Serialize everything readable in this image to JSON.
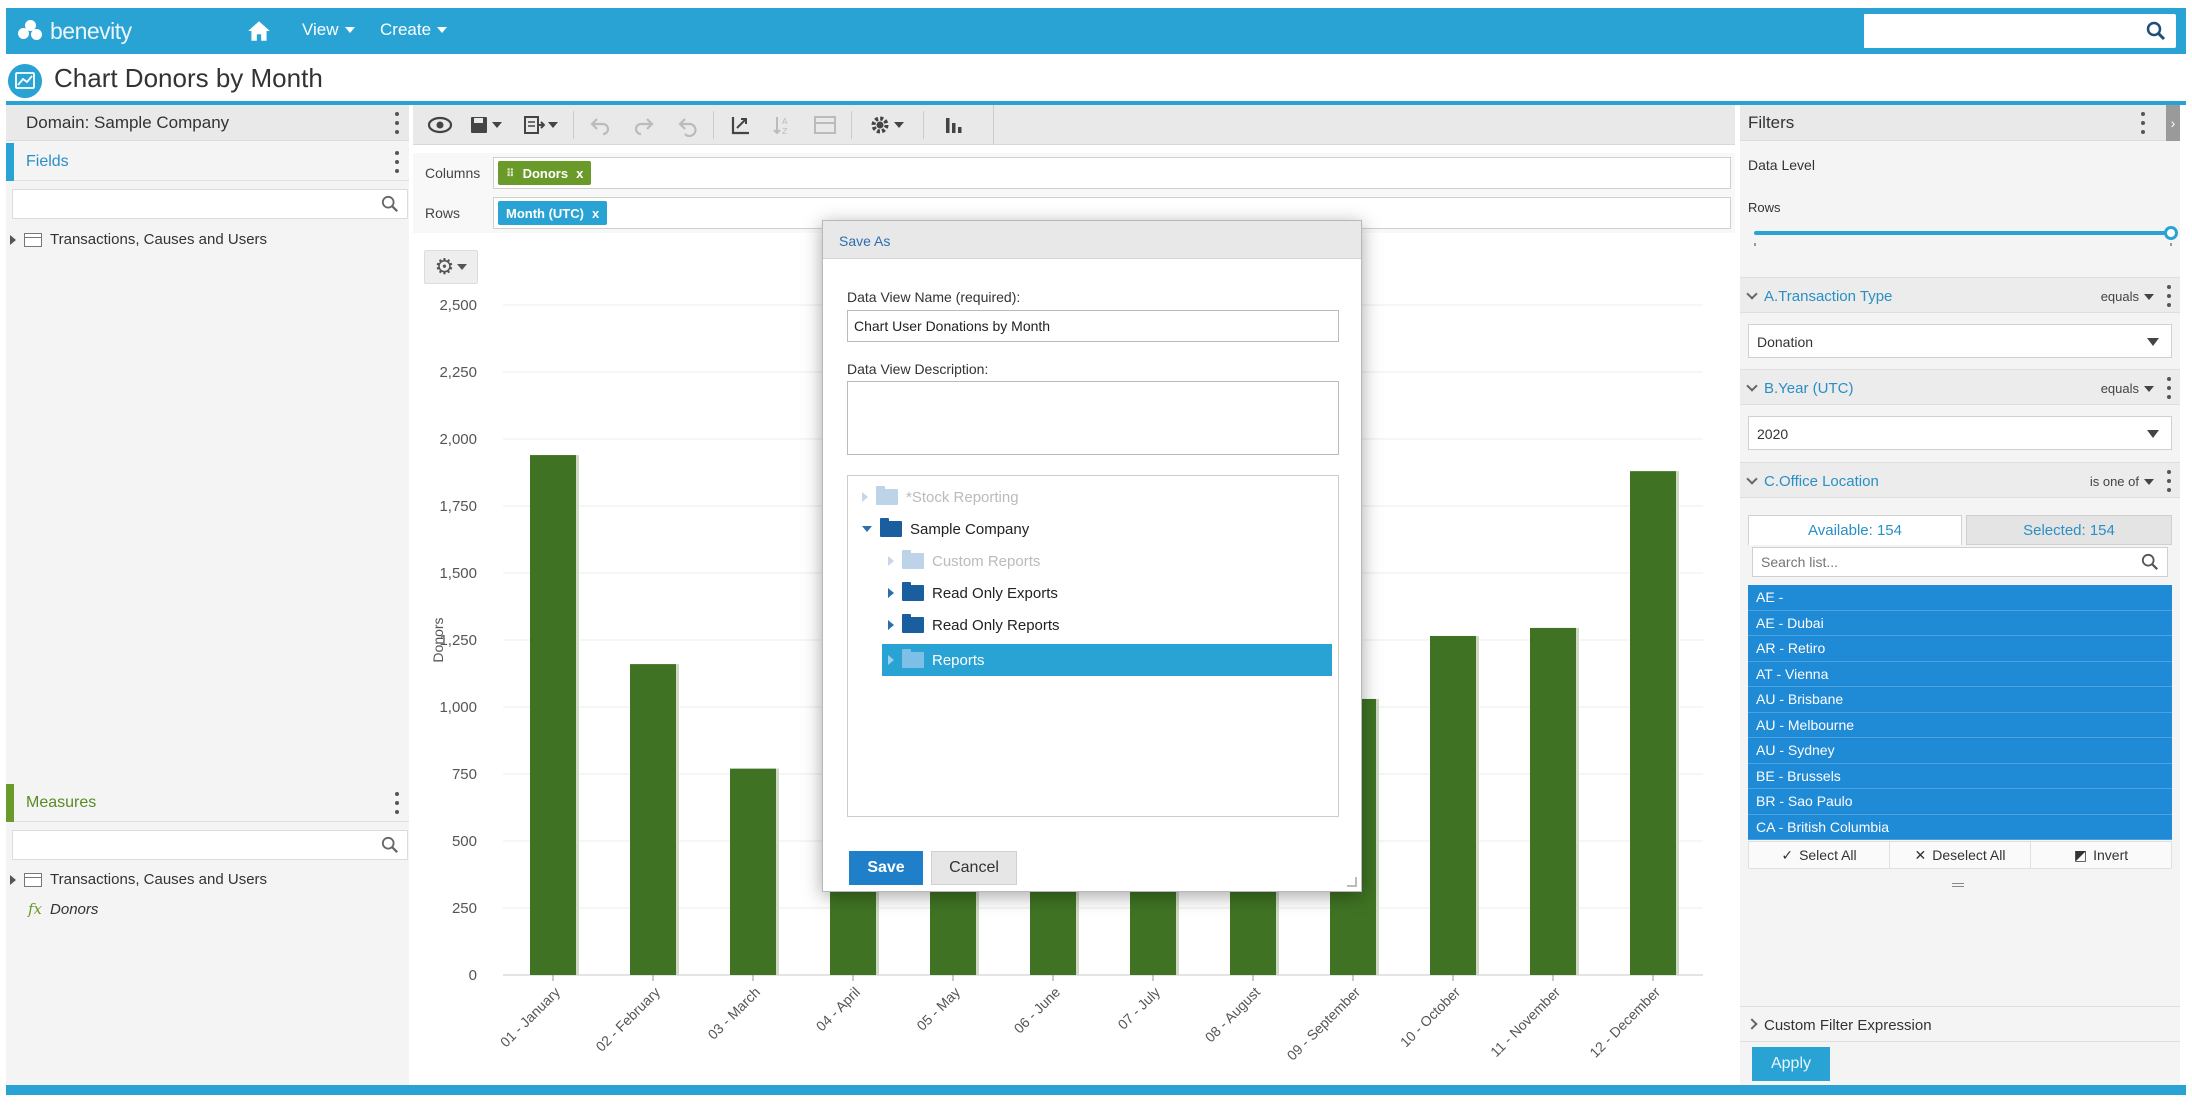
{
  "nav": {
    "brand": "benevity",
    "view_label": "View",
    "create_label": "Create",
    "search_placeholder": ""
  },
  "page": {
    "title": "Chart Donors by Month"
  },
  "left_panel": {
    "domain_label": "Domain: Sample Company",
    "fields_label": "Fields",
    "fields_tree_item": "Transactions, Causes and Users",
    "measures_label": "Measures",
    "measures_tree_item": "Transactions, Causes and Users",
    "measure_fx": "fx",
    "measure_item": "Donors"
  },
  "toolbar": {
    "columns_label": "Columns",
    "rows_label": "Rows",
    "columns_pill": "Donors",
    "rows_pill": "Month (UTC)",
    "pill_remove": "x"
  },
  "chart_data": {
    "type": "bar",
    "categories": [
      "01 - January",
      "02 - February",
      "03 - March",
      "04 - April",
      "05 - May",
      "06 - June",
      "07 - July",
      "08 - August",
      "09 - September",
      "10 - October",
      "11 - November",
      "12 - December"
    ],
    "values": [
      1940,
      1160,
      770,
      600,
      700,
      800,
      850,
      900,
      1030,
      1265,
      1295,
      1880
    ],
    "ylabel": "Donors",
    "xlabel": "",
    "ylim": [
      0,
      2500
    ],
    "yticks": [
      0,
      250,
      500,
      750,
      "1,000",
      "1,250",
      "1,500",
      "1,750",
      "2,000",
      "2,250",
      "2,500"
    ],
    "bar_color": "#3f7323",
    "grid": true
  },
  "dialog": {
    "title": "Save As",
    "name_label": "Data View Name (required):",
    "name_value": "Chart User Donations by Month",
    "description_label": "Data View Description:",
    "description_value": "",
    "folders": [
      {
        "label": "*Stock Reporting",
        "state": "disabled"
      },
      {
        "label": "Sample Company",
        "state": "expanded"
      },
      {
        "label": "Custom Reports",
        "state": "disabled"
      },
      {
        "label": "Read Only Exports",
        "state": "normal"
      },
      {
        "label": "Read Only Reports",
        "state": "normal"
      },
      {
        "label": "Reports",
        "state": "selected"
      }
    ],
    "save_label": "Save",
    "cancel_label": "Cancel"
  },
  "filters": {
    "title": "Filters",
    "data_level_label": "Data Level",
    "data_level_value": "Rows",
    "filter_a": {
      "name": "A.Transaction Type",
      "operator": "equals",
      "value": "Donation"
    },
    "filter_b": {
      "name": "B.Year (UTC)",
      "operator": "equals",
      "value": "2020"
    },
    "filter_c": {
      "name": "C.Office Location",
      "operator": "is one of"
    },
    "available_tab": "Available: 154",
    "selected_tab": "Selected: 154",
    "list_search_placeholder": "Search list...",
    "options": [
      "AE -",
      "AE - Dubai",
      "AR - Retiro",
      "AT - Vienna",
      "AU - Brisbane",
      "AU - Melbourne",
      "AU - Sydney",
      "BE - Brussels",
      "BR - Sao Paulo",
      "CA - British Columbia"
    ],
    "select_all": "Select All",
    "deselect_all": "Deselect All",
    "invert": "Invert",
    "custom_expression_label": "Custom Filter Expression",
    "apply_label": "Apply"
  },
  "colors": {
    "brand_blue": "#29a3d4",
    "bar_green": "#3f7323",
    "option_blue": "#1f8ad6",
    "save_blue": "#1f7fc9"
  }
}
